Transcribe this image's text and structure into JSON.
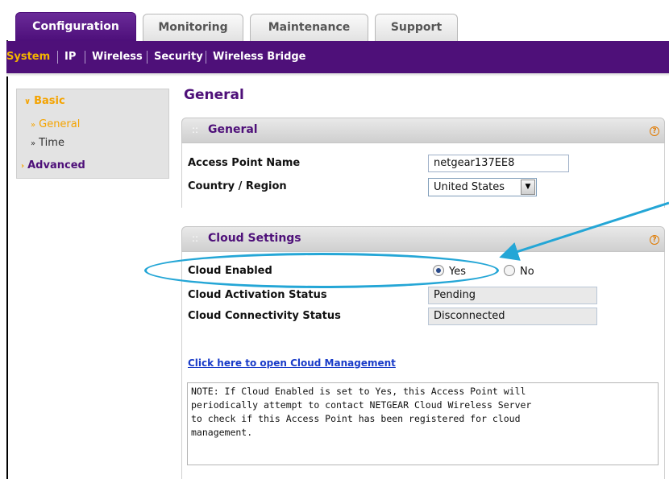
{
  "tabs": [
    {
      "label": "Configuration",
      "active": true
    },
    {
      "label": "Monitoring",
      "active": false
    },
    {
      "label": "Maintenance",
      "active": false
    },
    {
      "label": "Support",
      "active": false
    }
  ],
  "submenu": [
    {
      "label": "System",
      "active": true
    },
    {
      "label": "IP",
      "active": false
    },
    {
      "label": "Wireless",
      "active": false
    },
    {
      "label": "Security",
      "active": false
    },
    {
      "label": "Wireless Bridge",
      "active": false
    }
  ],
  "leftnav": {
    "basic": "Basic",
    "general": "General",
    "time": "Time",
    "advanced": "Advanced"
  },
  "page_title": "General",
  "general_section": {
    "title": "General",
    "ap_name_label": "Access Point Name",
    "ap_name_value": "netgear137EE8",
    "country_label": "Country / Region",
    "country_value": "United States"
  },
  "cloud_section": {
    "title": "Cloud Settings",
    "enabled_label": "Cloud Enabled",
    "yes_label": "Yes",
    "no_label": "No",
    "selected": "Yes",
    "activation_label": "Cloud Activation Status",
    "activation_value": "Pending",
    "connectivity_label": "Cloud Connectivity Status",
    "connectivity_value": "Disconnected",
    "link_text": "Click here to open Cloud Management",
    "note": "NOTE: If Cloud Enabled is set to Yes, this Access Point will\nperiodically attempt to contact NETGEAR Cloud Wireless Server\nto check if this Access Point has been registered for cloud\nmanagement."
  },
  "colors": {
    "brand_purple": "#4e1079",
    "accent_orange": "#f4a300",
    "callout_blue": "#24a6d6"
  }
}
